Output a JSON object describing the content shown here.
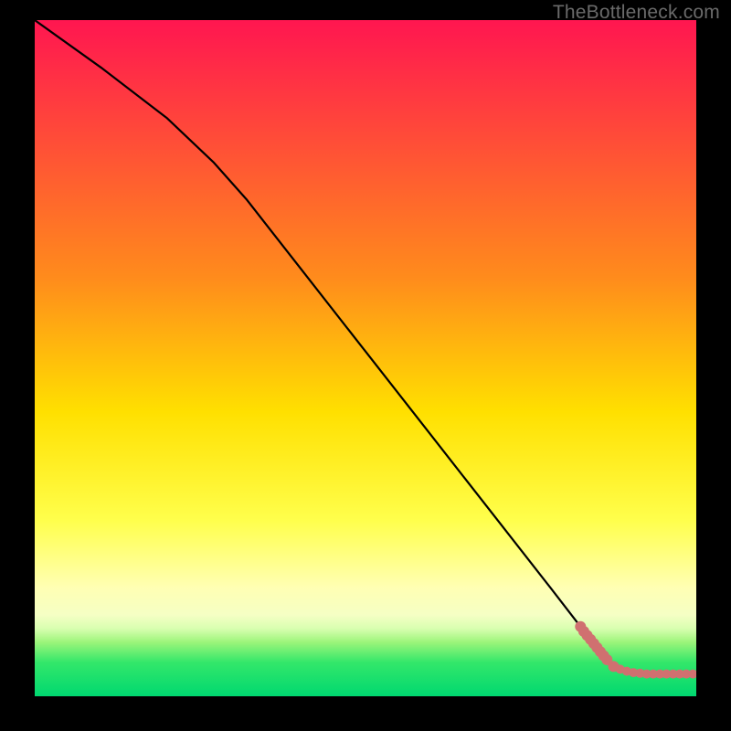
{
  "watermark": "TheBottleneck.com",
  "colors": {
    "background": "#000000",
    "gradient_top": "#ff1650",
    "gradient_bottom": "#00d870",
    "curve": "#000000",
    "dots": "#d07070"
  },
  "chart_data": {
    "type": "line",
    "title": "",
    "xlabel": "",
    "ylabel": "",
    "xlim": [
      0,
      100
    ],
    "ylim": [
      0,
      100
    ],
    "grid": false,
    "legend": false,
    "note": "Axes are unlabeled in the source image; x/y are percentage-style positions within the plot area (0–100). Values are estimated from pixel positions.",
    "series": [
      {
        "name": "curve",
        "render": "line",
        "x": [
          0.0,
          10.0,
          20.0,
          27.0,
          32.0,
          40.0,
          50.0,
          60.0,
          70.0,
          78.0,
          82.5,
          84.5,
          87.0
        ],
        "y": [
          100.0,
          93.0,
          85.5,
          79.0,
          73.5,
          63.5,
          51.0,
          38.5,
          26.0,
          16.0,
          10.3,
          7.8,
          4.8
        ]
      },
      {
        "name": "scatter-tail",
        "render": "scatter",
        "x": [
          82.5,
          83.0,
          83.5,
          84.0,
          84.5,
          85.0,
          85.5,
          86.0,
          86.5,
          87.5,
          88.5,
          89.5,
          90.5,
          91.5,
          92.5,
          93.5,
          94.5,
          95.5,
          96.5,
          97.5,
          98.5,
          99.5
        ],
        "y": [
          10.3,
          9.6,
          9.0,
          8.4,
          7.8,
          7.2,
          6.6,
          6.0,
          5.4,
          4.4,
          4.0,
          3.7,
          3.5,
          3.4,
          3.3,
          3.3,
          3.3,
          3.3,
          3.3,
          3.3,
          3.3,
          3.3
        ]
      }
    ]
  }
}
